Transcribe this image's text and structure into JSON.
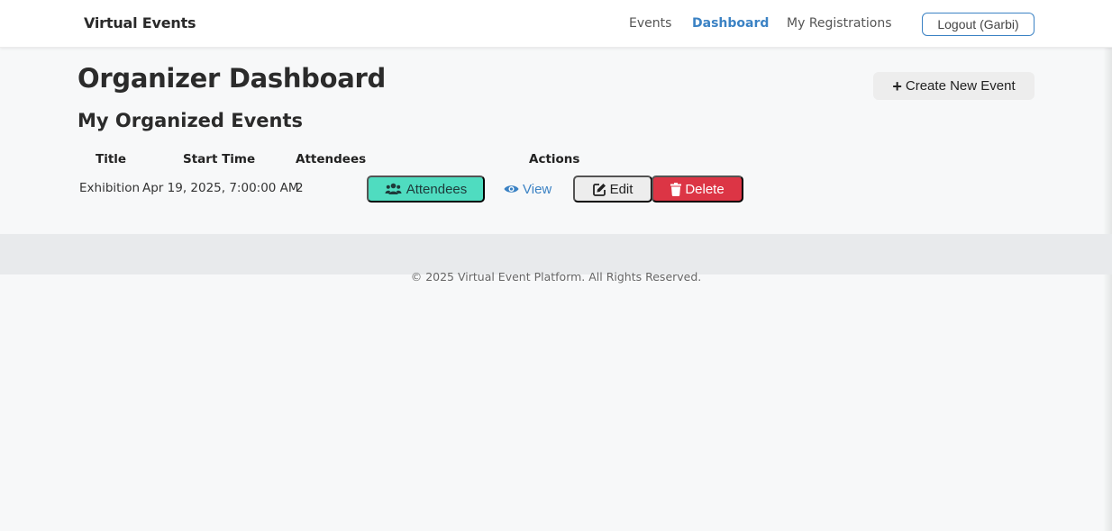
{
  "navbar": {
    "brand": "Virtual Events",
    "links": [
      {
        "label": "Events",
        "active": false
      },
      {
        "label": "Dashboard",
        "active": true
      },
      {
        "label": "My Registrations",
        "active": false
      }
    ],
    "logout_label": "Logout (Garbi)"
  },
  "page": {
    "title": "Organizer Dashboard",
    "create_button_label": "Create New Event",
    "section_title": "My Organized Events"
  },
  "table": {
    "headers": {
      "title": "Title",
      "start_time": "Start Time",
      "attendees": "Attendees",
      "actions": "Actions"
    },
    "rows": [
      {
        "title": "Exhibition",
        "start_time": "Apr 19, 2025, 7:00:00 AM",
        "attendees": "2",
        "actions": {
          "attendees_label": "Attendees",
          "view_label": "View",
          "edit_label": "Edit",
          "delete_label": "Delete"
        }
      }
    ]
  },
  "footer": {
    "text": "© 2025 Virtual Event Platform. All Rights Reserved."
  },
  "colors": {
    "accent": "#3b82c4",
    "attendees_button": "#4fdcc0",
    "delete_button": "#dc3545",
    "neutral_button": "#ededed"
  },
  "icons": {
    "create": "plus-icon",
    "attendees": "users-icon",
    "view": "eye-icon",
    "edit": "edit-icon",
    "delete": "trash-icon"
  }
}
